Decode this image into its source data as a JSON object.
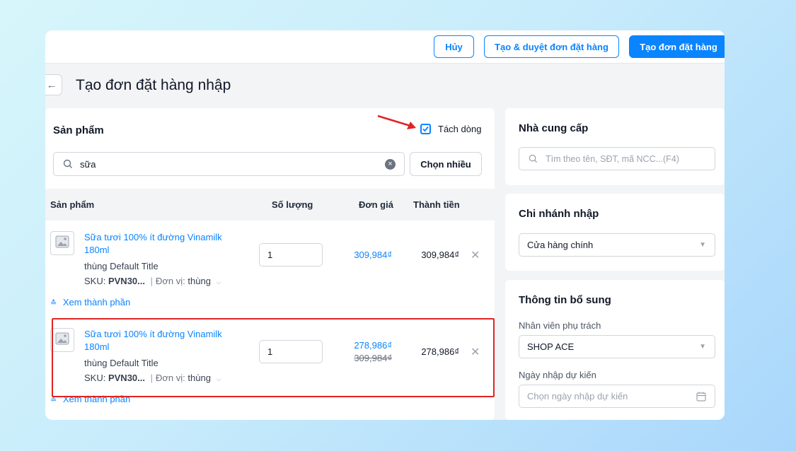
{
  "toolbar": {
    "cancel_label": "Hủy",
    "create_approve_label": "Tạo & duyệt đơn đặt hàng",
    "create_label": "Tạo đơn đặt hàng"
  },
  "page": {
    "title": "Tạo đơn đặt hàng nhập"
  },
  "products": {
    "title": "Sản phẩm",
    "split_lines_label": "Tách dòng",
    "split_lines_checked": true,
    "search_value": "sữa",
    "choose_many_label": "Chọn nhiều",
    "columns": {
      "product": "Sản phẩm",
      "quantity": "Số lượng",
      "unit_price": "Đơn giá",
      "line_total": "Thành tiền"
    },
    "items": [
      {
        "name": "Sữa tươi 100% ít đường Vinamilk 180ml",
        "variant": "thùng Default Title",
        "sku_label": "SKU:",
        "sku": "PVN30...",
        "unit_label": "Đơn vị:",
        "unit": "thùng",
        "quantity": "1",
        "price": "309,984₫",
        "total": "309,984₫",
        "expand_label": "Xem thành phần"
      },
      {
        "name": "Sữa tươi 100% ít đường Vinamilk 180ml",
        "variant": "thùng Default Title",
        "sku_label": "SKU:",
        "sku": "PVN30...",
        "unit_label": "Đơn vị:",
        "unit": "thùng",
        "quantity": "1",
        "price": "278,986₫",
        "old_price": "309,984₫",
        "total": "278,986₫",
        "expand_label": "Xem thành phần"
      }
    ]
  },
  "supplier": {
    "title": "Nhà cung cấp",
    "search_placeholder": "Tìm theo tên, SĐT, mã NCC...(F4)"
  },
  "branch": {
    "title": "Chi nhánh nhập",
    "selected": "Cửa hàng chính"
  },
  "extra": {
    "title": "Thông tin bổ sung",
    "staff_label": "Nhân viên phụ trách",
    "staff_value": "SHOP ACE",
    "date_label": "Ngày nhập dự kiến",
    "date_placeholder": "Chọn ngày nhập dự kiến"
  },
  "colors": {
    "accent": "#0a84ff",
    "highlight": "#e02424",
    "arrow": "#e02424"
  },
  "icons": [
    "back-arrow-icon",
    "search-icon",
    "clear-icon",
    "checkbox-icon",
    "image-placeholder-icon",
    "close-icon",
    "chevron-down-icon",
    "double-chevron-down-icon",
    "calendar-icon"
  ]
}
